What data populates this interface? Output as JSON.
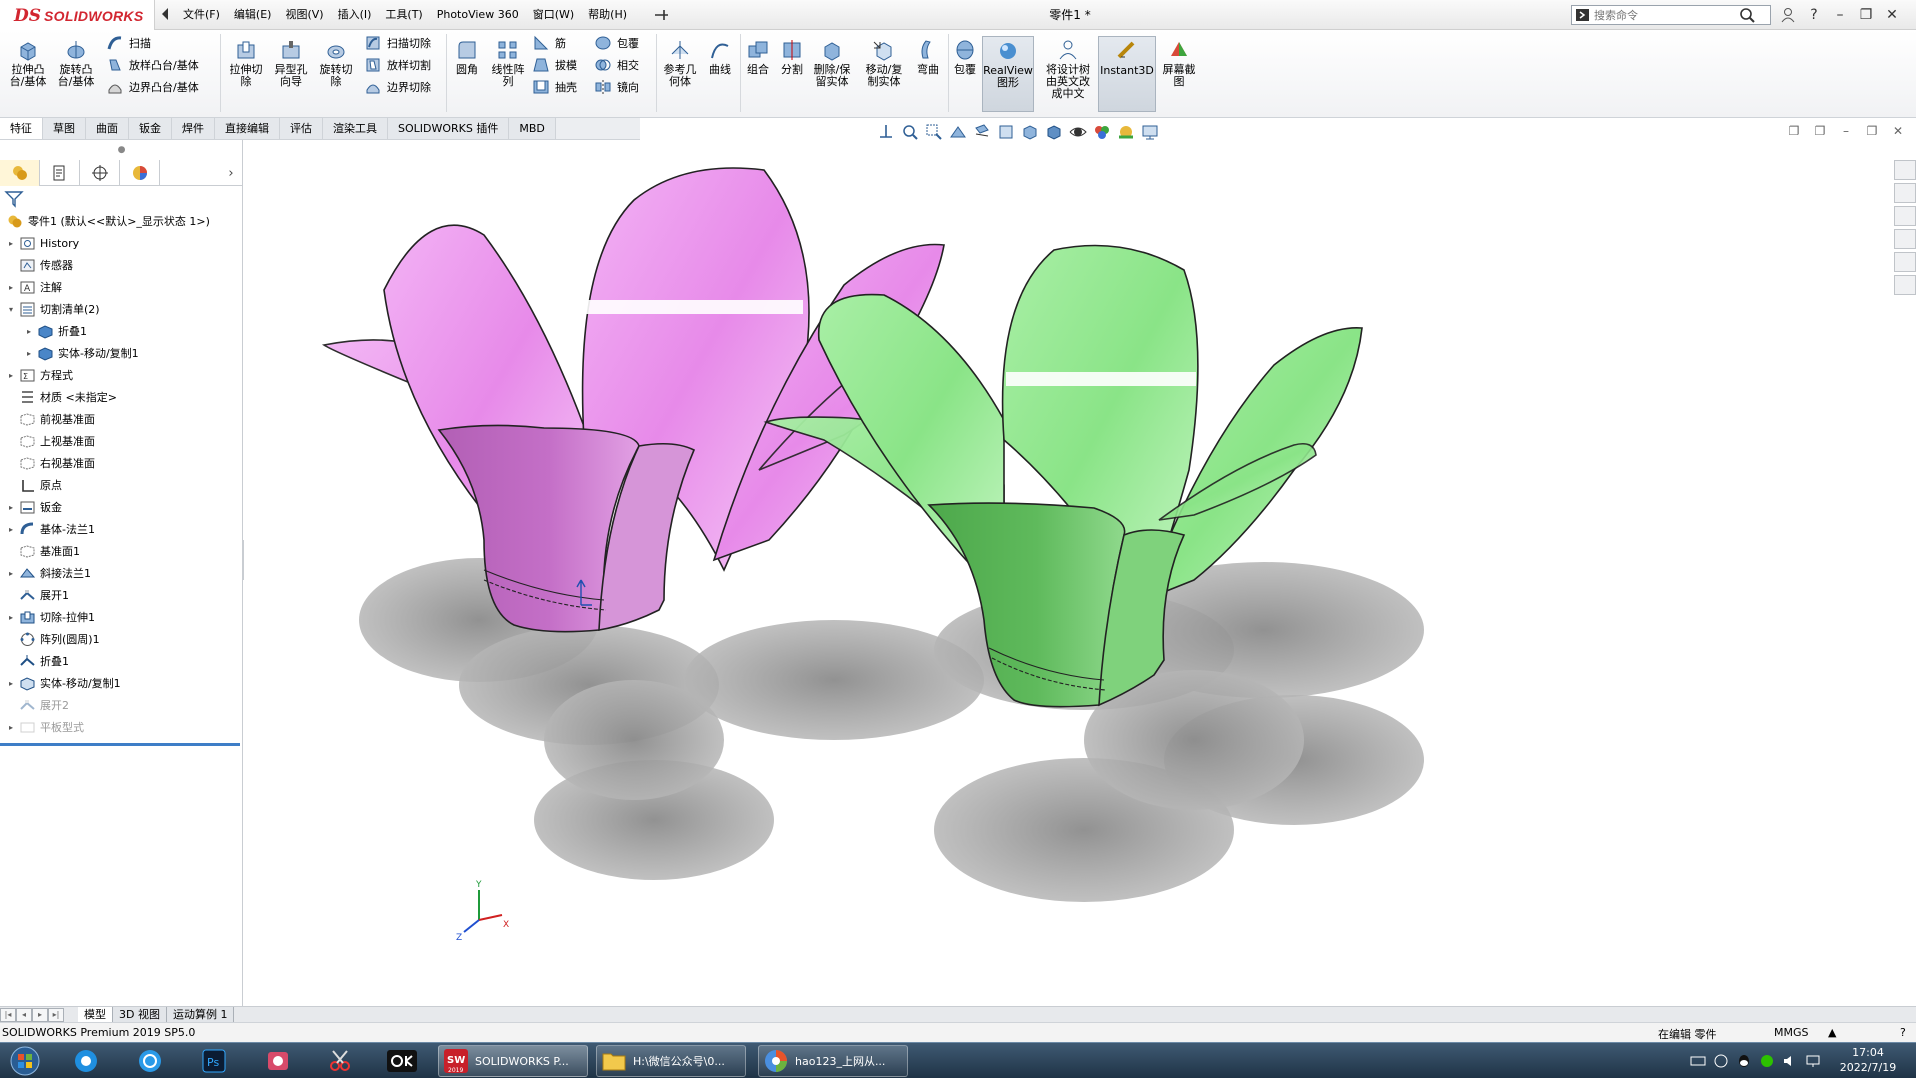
{
  "titlebar": {
    "logo_text": "SOLIDWORKS",
    "logo_mark": "DS",
    "menus": [
      "文件(F)",
      "编辑(E)",
      "视图(V)",
      "插入(I)",
      "工具(T)",
      "PhotoView 360",
      "窗口(W)",
      "帮助(H)"
    ],
    "document_title": "零件1 *",
    "search_placeholder": "搜索命令"
  },
  "command_manager": {
    "features": {
      "extrude_boss": "拉伸凸\n台/基体",
      "revolve_boss": "旋转凸\n台/基体",
      "sweep": "扫描",
      "loft": "放样凸台/基体",
      "boundary": "边界凸台/基体",
      "extrude_cut": "拉伸切\n除",
      "hole_wizard": "异型孔\n向导",
      "revolve_cut": "旋转切\n除",
      "swept_cut": "扫描切除",
      "lofted_cut": "放样切割",
      "boundary_cut": "边界切除",
      "fillet": "圆角",
      "linear_pattern": "线性阵\n列",
      "rib": "筋",
      "draft": "拔模",
      "shell": "抽壳",
      "wrap": "包覆",
      "intersect": "相交",
      "mirror": "镜向",
      "ref_geometry": "参考几\n何体",
      "curves": "曲线",
      "combine": "组合",
      "split": "分割",
      "delete_keep": "删除/保\n留实体",
      "move_copy": "移动/复\n制实体",
      "flex": "弯曲",
      "wrap2": "包覆",
      "realview": "RealView\n图形",
      "translate": "将设计树\n由英文改\n成中文",
      "instant3d": "Instant3D",
      "screenshot": "屏幕截\n图"
    }
  },
  "tabs": [
    "特征",
    "草图",
    "曲面",
    "钣金",
    "焊件",
    "直接编辑",
    "评估",
    "渲染工具",
    "SOLIDWORKS 插件",
    "MBD"
  ],
  "feature_tree": {
    "root": "零件1 (默认<<默认>_显示状态 1>)",
    "nodes": [
      {
        "label": "History",
        "icon": "history-folder-icon",
        "toggle": "▸",
        "level": 0
      },
      {
        "label": "传感器",
        "icon": "sensor-icon",
        "toggle": "",
        "level": 0
      },
      {
        "label": "注解",
        "icon": "annotation-icon",
        "toggle": "▸",
        "level": 0
      },
      {
        "label": "切割清单(2)",
        "icon": "cut-list-icon",
        "toggle": "▾",
        "level": 0
      },
      {
        "label": "折叠1",
        "icon": "solid-body-icon",
        "toggle": "▸",
        "level": 1
      },
      {
        "label": "实体-移动/复制1",
        "icon": "solid-body-icon",
        "toggle": "▸",
        "level": 1
      },
      {
        "label": "方程式",
        "icon": "equation-icon",
        "toggle": "▸",
        "level": 0
      },
      {
        "label": "材质 <未指定>",
        "icon": "material-icon",
        "toggle": "",
        "level": 0
      },
      {
        "label": "前视基准面",
        "icon": "plane-icon",
        "toggle": "",
        "level": 0
      },
      {
        "label": "上视基准面",
        "icon": "plane-icon",
        "toggle": "",
        "level": 0
      },
      {
        "label": "右视基准面",
        "icon": "plane-icon",
        "toggle": "",
        "level": 0
      },
      {
        "label": "原点",
        "icon": "origin-icon",
        "toggle": "",
        "level": 0
      },
      {
        "label": "钣金",
        "icon": "sheet-metal-icon",
        "toggle": "▸",
        "level": 0
      },
      {
        "label": "基体-法兰1",
        "icon": "base-flange-icon",
        "toggle": "▸",
        "level": 0
      },
      {
        "label": "基准面1",
        "icon": "plane-icon",
        "toggle": "",
        "level": 0
      },
      {
        "label": "斜接法兰1",
        "icon": "miter-flange-icon",
        "toggle": "▸",
        "level": 0
      },
      {
        "label": "展开1",
        "icon": "unfold-icon",
        "toggle": "",
        "level": 0
      },
      {
        "label": "切除-拉伸1",
        "icon": "cut-extrude-icon",
        "toggle": "▸",
        "level": 0
      },
      {
        "label": "阵列(圆周)1",
        "icon": "circular-pattern-icon",
        "toggle": "",
        "level": 0
      },
      {
        "label": "折叠1",
        "icon": "fold-icon",
        "toggle": "",
        "level": 0
      },
      {
        "label": "实体-移动/复制1",
        "icon": "move-copy-icon",
        "toggle": "▸",
        "level": 0
      },
      {
        "label": "展开2",
        "icon": "unfold-icon",
        "toggle": "",
        "level": 0,
        "dim": true
      },
      {
        "label": "平板型式",
        "icon": "flat-pattern-icon",
        "toggle": "▸",
        "level": 0,
        "dim": true
      }
    ]
  },
  "bottom_tabs": [
    "模型",
    "3D 视图",
    "运动算例 1"
  ],
  "status": {
    "product": "SOLIDWORKS Premium 2019 SP5.0",
    "mode": "在编辑 零件",
    "units": "MMGS",
    "units_arrow": "▲"
  },
  "triad": {
    "x": "X",
    "y": "Y",
    "z": "Z"
  },
  "taskbar": {
    "windows": [
      {
        "label": "SOLIDWORKS P...",
        "icon": "solidworks-icon"
      },
      {
        "label": "H:\\微信公众号\\0...",
        "icon": "folder-icon"
      },
      {
        "label": "hao123_上网从...",
        "icon": "browser-icon"
      }
    ],
    "time": "17:04",
    "date": "2022/7/19",
    "sw_badge": "2019"
  },
  "colors": {
    "pink_body": "#e58be8",
    "green_body": "#7ee07e",
    "accent": "#3e7ec7",
    "brand_red": "#d22630"
  }
}
